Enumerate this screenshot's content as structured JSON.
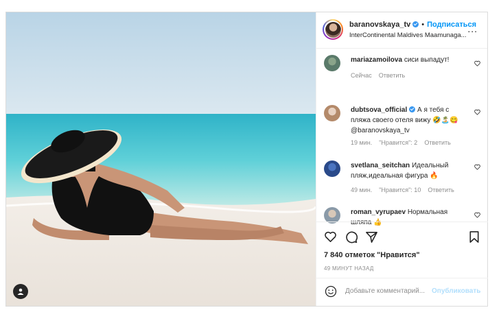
{
  "header": {
    "username": "baranovskaya_tv",
    "separator": "•",
    "follow_label": "Подписаться",
    "location": "InterContinental Maldives Maamunaga...",
    "more_label": "..."
  },
  "comments": [
    {
      "user": "mariazamoilova",
      "text": "сиси выпадут!",
      "time": "Сейчас",
      "likes": "",
      "reply": "Ответить"
    },
    {
      "user": "dubtsova_official",
      "text": "А я тебя с пляжа своего отеля вижу 🤣🏝️😋 @baranovskaya_tv",
      "time": "19 мин.",
      "likes": "\"Нравится\": 2",
      "reply": "Ответить"
    },
    {
      "user": "svetlana_seitchan",
      "text": "Идеальный пляж,идеальная фигура 🔥",
      "time": "49 мин.",
      "likes": "\"Нравится\": 10",
      "reply": "Ответить"
    },
    {
      "user": "roman_vyrupaev",
      "text": "Нормальная шляпа 👍",
      "time": "",
      "likes": "",
      "reply": ""
    }
  ],
  "footer": {
    "likes": "7 840 отметок \"Нравится\"",
    "time_ago": "49 МИНУТ НАЗАД",
    "add_comment_placeholder": "Добавьте комментарий...",
    "publish_label": "Опубликовать"
  },
  "colors": {
    "accent": "#0095f6",
    "muted": "#8e8e8e",
    "publish_disabled": "#b2dffc",
    "sea": "#4fc3d4",
    "sky": "#c9dfec",
    "sand": "#efe9e2"
  },
  "icons": [
    "heart-icon",
    "comment-icon",
    "share-icon",
    "bookmark-icon",
    "emoji-icon",
    "user-tag-icon",
    "verified-icon",
    "more-icon"
  ]
}
